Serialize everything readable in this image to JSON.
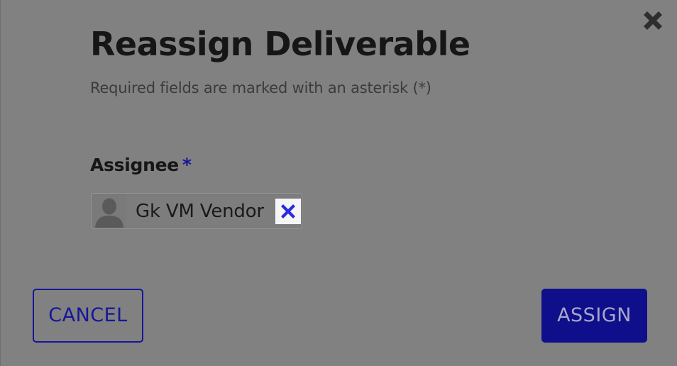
{
  "dialog": {
    "title": "Reassign Deliverable",
    "subtitle": "Required fields are marked with an asterisk (*)",
    "close_icon": "close-x-icon"
  },
  "assignee": {
    "label": "Assignee",
    "required_marker": "*",
    "selected": {
      "name": "Gk VM Vendor",
      "avatar_icon": "user-silhouette-icon",
      "remove_icon": "remove-x-icon"
    }
  },
  "actions": {
    "cancel_label": "CANCEL",
    "assign_label": "ASSIGN"
  },
  "colors": {
    "overlay_gray": "#818181",
    "accent_navy": "#0f0f8c",
    "remove_blue": "#2a2ae0",
    "title_text": "#161616"
  }
}
